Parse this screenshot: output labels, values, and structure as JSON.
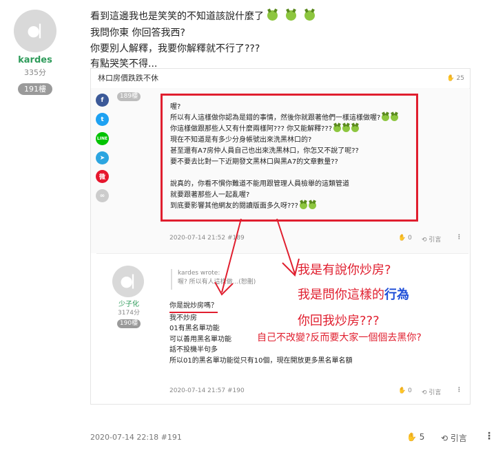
{
  "outer": {
    "username": "kardes",
    "score": "335分",
    "floor": "191樓",
    "lines": [
      "看到這邊我也是笑笑的不知道該說什麼了",
      "我問你東 你回答我西?",
      "你要別人解釋，我要你解釋就不行了???",
      "有點哭笑不得..."
    ],
    "timestamp": "2020-07-14 22:18 #191",
    "like_count": "5",
    "quote_label": "引言"
  },
  "card": {
    "title": "林口房價跌跌不休",
    "like_count": "25",
    "post189": {
      "floor": "189樓",
      "lines": [
        "喔?",
        "所以有人這樣做你認為是錯的事情，然後你就跟著他們一樣這樣做喔?",
        "你這樣做跟那些人又有什麼兩樣阿??? 你又能解釋???",
        "現在不知道是有多少分身帳號出來洗黑林口的?",
        "甚至還有A7房仲人員自己也出來洗黑林口，你怎又不說了呢??",
        "要不要去比對一下近期發文黑林口與黑A7的文章數量??",
        "",
        "說真的，你看不慣你難道不能用跟管理人員檢舉的這類管道",
        "就要跟著那些人一起亂喔?",
        "到底要影響其他網友的閱讀版面多久呀???"
      ],
      "timestamp": "2020-07-14 21:52 #189",
      "like_count": "0",
      "quote_label": "引言"
    },
    "post190": {
      "username": "少子化",
      "score": "3174分",
      "floor": "190樓",
      "quote_author": "kardes wrote:",
      "quote_text": "喔? 所以有人這樣做...(恕刪)",
      "lines": [
        "你是說炒房嗎？",
        "我不炒房",
        "01有黑名單功能",
        "可以善用黑名單功能",
        "話不投機半句多",
        "所以01的黑名單功能從只有10個，現在開放更多黑名單名額"
      ],
      "timestamp": "2020-07-14 21:57 #190",
      "like_count": "0",
      "quote_label": "引言"
    }
  },
  "annotation": {
    "line1": "我是有說你炒房?",
    "line2_a": "我是問你這樣的",
    "line2_b": "行為",
    "line3": "你回我炒房???",
    "line4": "自己不改變?反而要大家一個個去黑你?"
  },
  "share_icons": [
    "facebook-icon",
    "twitter-icon",
    "line-icon",
    "telegram-icon",
    "weibo-icon",
    "link-icon"
  ],
  "colors": {
    "accent_red": "#e01e2e",
    "username_green": "#2e9b5a",
    "annotation_blue": "#1f4fd8"
  }
}
